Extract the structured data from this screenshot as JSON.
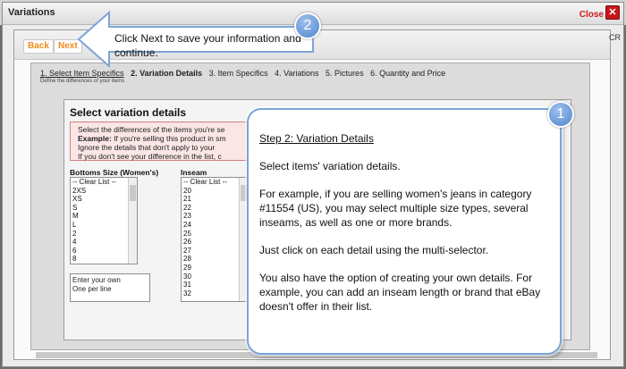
{
  "window": {
    "title": "Variations",
    "close_label": "Close",
    "close_glyph": "✕",
    "cr_text": "CR"
  },
  "nav": {
    "back_label": "Back",
    "next_label": "Next"
  },
  "steps": {
    "items": [
      "1. Select Item Specifics",
      "2. Variation Details",
      "3. Item Specifics",
      "4. Variations",
      "5. Pictures",
      "6. Quantity and Price"
    ],
    "subtitle": "Define the differences of your items"
  },
  "form": {
    "title": "Select variation details",
    "info_line1": "Select the differences of the items you're se",
    "info_example_label": "Example:",
    "info_line2_rest": "If you're selling this product in sm",
    "info_line3": "Ignore the details that don't apply to your",
    "info_line4": "If you don't see your difference in the list, c",
    "bottoms_label": "Bottoms Size (Women's)",
    "bottoms_items": [
      "-- Clear List --",
      "2XS",
      "XS",
      "S",
      "M",
      "L",
      "2",
      "4",
      "6",
      "8"
    ],
    "inseam_label": "Inseam",
    "inseam_items": [
      "-- Clear List --",
      "20",
      "21",
      "22",
      "23",
      "24",
      "25",
      "26",
      "27",
      "28",
      "29",
      "30",
      "31",
      "32"
    ],
    "own_line1": "Enter your own",
    "own_line2": "One per line"
  },
  "callout1": {
    "badge": "1",
    "heading": "Step 2: Variation Details",
    "p1": "Select items' variation details.",
    "p2": "For example, if you are selling women's jeans in category #11554 (US), you may select multiple size types, several inseams, as well as one or more brands.",
    "p3": "Just click on each detail using the multi-selector.",
    "p4": "You also have the option of creating your own details. For example, you can add an inseam length or brand that eBay doesn't offer in their list."
  },
  "callout2": {
    "badge": "2",
    "text": "Click Next to save your information and continue."
  },
  "colors": {
    "accent_orange": "#f08a19",
    "close_red": "#c8161c",
    "callout_border": "#7da4d7"
  }
}
